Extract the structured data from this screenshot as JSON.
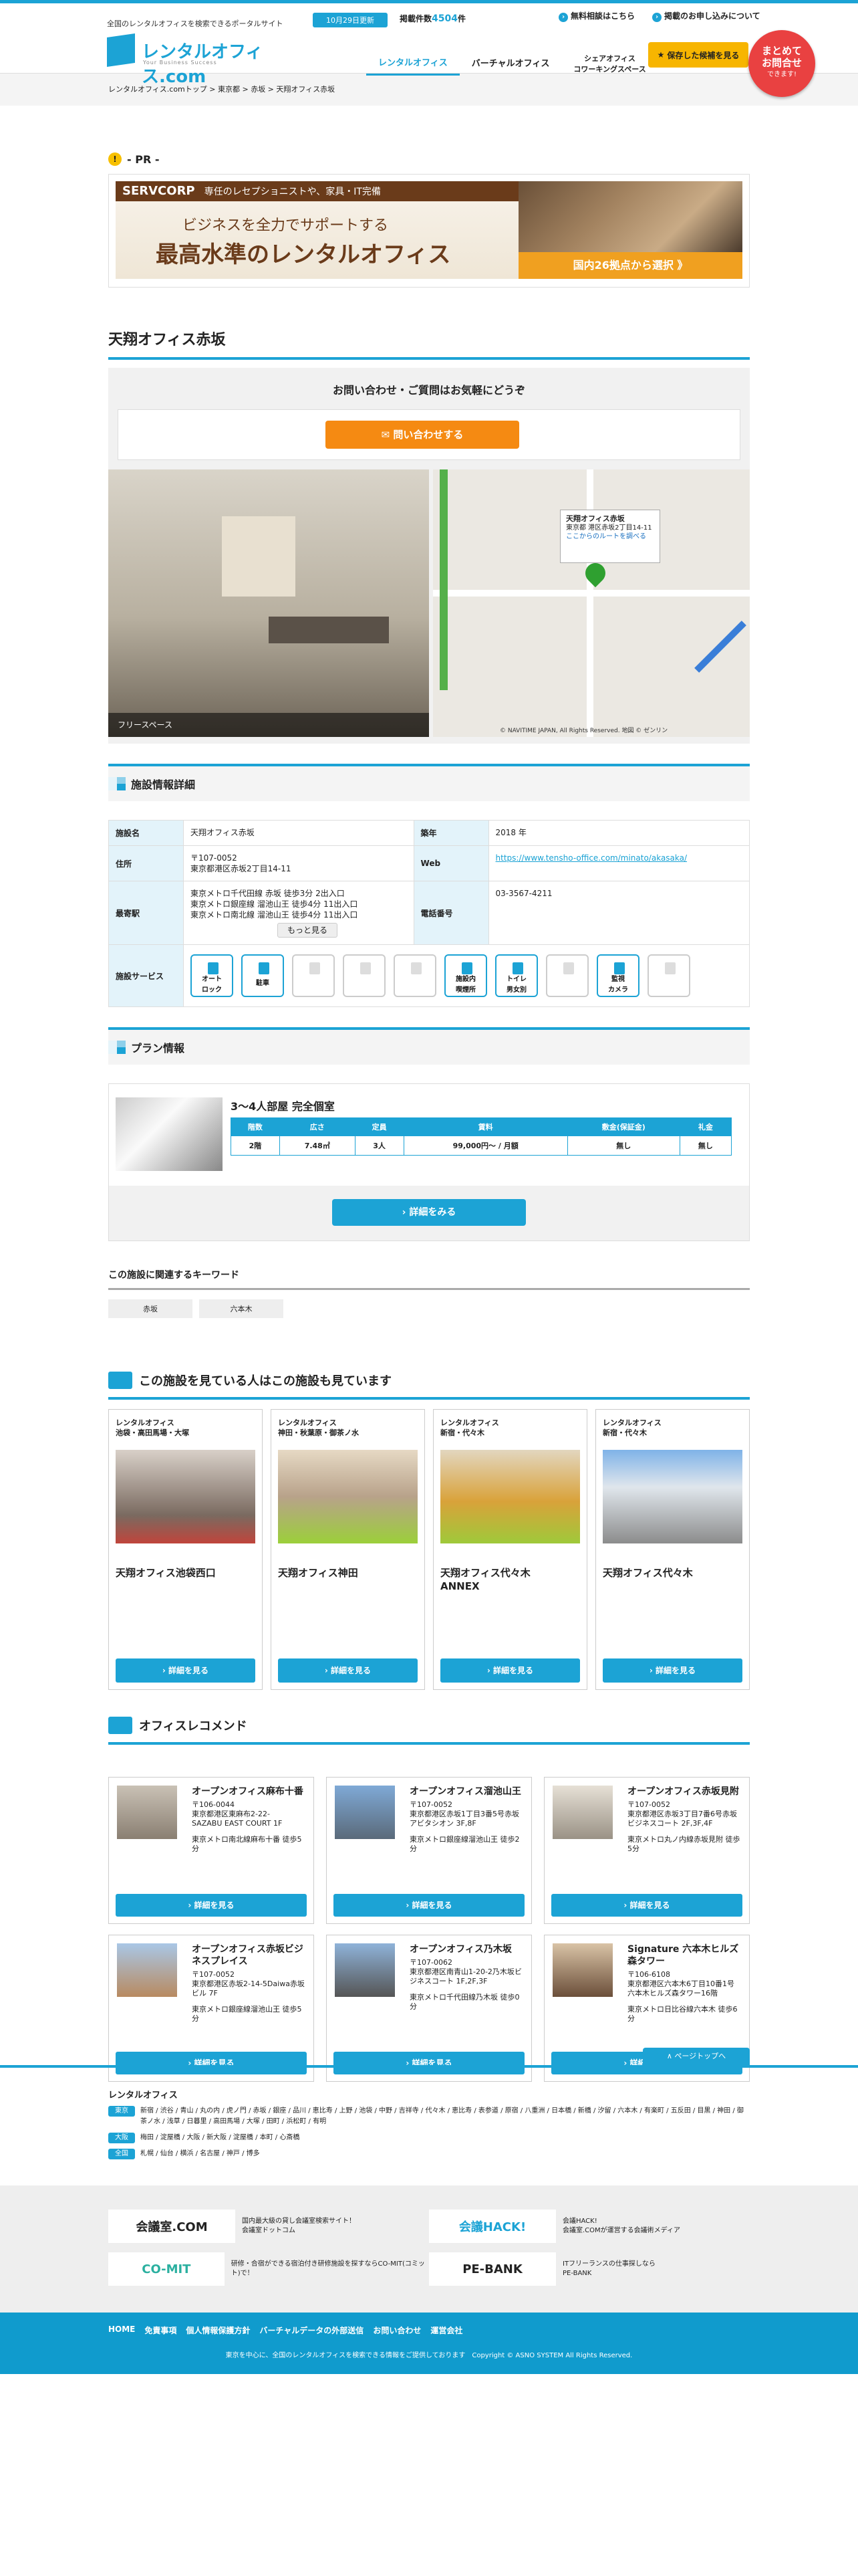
{
  "header": {
    "tagline": "全国のレンタルオフィスを検索できるポータルサイト",
    "logo": "レンタルオフィス.com",
    "logo_sub": "Your Business Success",
    "updated": "10月29日更新",
    "count_label": "掲載件数",
    "count": "4504",
    "count_unit": "件",
    "links": [
      "無料相談はこちら",
      "掲載のお申し込みについて"
    ],
    "nav": [
      "レンタルオフィス",
      "バーチャルオフィス",
      "シェアオフィス\nコワーキングスペース"
    ],
    "fav": "保存した候補を見る",
    "matome": "まとめて\nお問合せ",
    "matome_sub": "できます!"
  },
  "breadcrumb": "レンタルオフィス.comトップ > 東京都 > 赤坂 > 天翔オフィス赤坂",
  "pr": {
    "label": "- PR -",
    "brand": "SERVCORP",
    "top": "専任のレセプショニストや、家具・IT完備",
    "mid": "ビジネスを全力でサポートする",
    "big": "最高水準のレンタルオフィス",
    "cta": "国内26拠点から選択 》"
  },
  "facility": {
    "name": "天翔オフィス赤坂",
    "inquiry_title": "お問い合わせ・ご質問はお気軽にどうぞ",
    "inquiry_button": "問い合わせする",
    "photo_caption": "フリースペース",
    "map_name": "天翔オフィス赤坂",
    "map_addr": "東京都 港区赤坂2丁目14-11",
    "map_link": "ここからのルートを調べる",
    "map_copy": "© NAVITIME JAPAN, All Rights Reserved. 地図 © ゼンリン"
  },
  "detail": {
    "title": "施設情報詳細",
    "name_k": "施設名",
    "name_v": "天翔オフィス赤坂",
    "year_k": "築年",
    "year_v": "2018 年",
    "addr_k": "住所",
    "addr_v1": "〒107-0052",
    "addr_v2": "東京都港区赤坂2丁目14-11",
    "web_k": "Web",
    "web_v": "https://www.tensho-office.com/minato/akasaka/",
    "st_k": "最寄駅",
    "st_v1": "東京メトロ千代田線 赤坂 徒歩3分 2出入口",
    "st_v2": "東京メトロ銀座線 溜池山王 徒歩4分 11出入口",
    "st_v3": "東京メトロ南北線 溜池山王 徒歩4分 11出入口",
    "more": "もっと見る",
    "tel_k": "電話番号",
    "tel_v": "03-3567-4211",
    "svc_k": "施設サービス",
    "services": [
      "オート\nロック",
      "駐車",
      "",
      "",
      "",
      "施設内\n喫煙所",
      "トイレ\n男女別",
      "",
      "監視\nカメラ",
      ""
    ]
  },
  "plan": {
    "title": "プラン情報",
    "room": "3〜4人部屋 完全個室",
    "heads": [
      "階数",
      "広さ",
      "定員",
      "賃料",
      "敷金(保証金)",
      "礼金"
    ],
    "vals": [
      "2階",
      "7.48㎡",
      "3人",
      "99,000円〜 / 月額",
      "無し",
      "無し"
    ],
    "button": "詳細をみる"
  },
  "keywords": {
    "title": "この施設に関連するキーワード",
    "items": [
      "赤坂",
      "六本木"
    ]
  },
  "also": {
    "title": "この施設を見ている人はこの施設も見ています",
    "cards": [
      {
        "cat": "レンタルオフィス",
        "area": "池袋・高田馬場・大塚",
        "name": "天翔オフィス池袋西口"
      },
      {
        "cat": "レンタルオフィス",
        "area": "神田・秋葉原・御茶ノ水",
        "name": "天翔オフィス神田"
      },
      {
        "cat": "レンタルオフィス",
        "area": "新宿・代々木",
        "name": "天翔オフィス代々木\nANNEX"
      },
      {
        "cat": "レンタルオフィス",
        "area": "新宿・代々木",
        "name": "天翔オフィス代々木"
      }
    ],
    "button": "詳細を見る"
  },
  "recommend": {
    "title": "オフィスレコメンド",
    "button": "詳細を見る",
    "items": [
      {
        "name": "オープンオフィス麻布十番",
        "zip": "〒106-0044",
        "addr": "東京都港区東麻布2-22-\nSAZABU EAST COURT 1F",
        "st": "東京メトロ南北線麻布十番 徒歩5分"
      },
      {
        "name": "オープンオフィス溜池山王",
        "zip": "〒107-0052",
        "addr": "東京都港区赤坂1丁目3番5号赤坂アビタシオン 3F,8F",
        "st": "東京メトロ銀座線溜池山王 徒歩2分"
      },
      {
        "name": "オープンオフィス赤坂見附",
        "zip": "〒107-0052",
        "addr": "東京都港区赤坂3丁目7番6号赤坂ビジネスコート 2F,3F,4F",
        "st": "東京メトロ丸ノ内線赤坂見附 徒歩5分"
      },
      {
        "name": "オープンオフィス赤坂ビジネスプレイス",
        "zip": "〒107-0052",
        "addr": "東京都港区赤坂2-14-5Daiwa赤坂ビル 7F",
        "st": "東京メトロ銀座線溜池山王 徒歩5分"
      },
      {
        "name": "オープンオフィス乃木坂",
        "zip": "〒107-0062",
        "addr": "東京都港区南青山1-20-2乃木坂ビジネスコート 1F,2F,3F",
        "st": "東京メトロ千代田線乃木坂 徒歩0分"
      },
      {
        "name": "Signature 六本木ヒルズ森タワー",
        "zip": "〒106-6108",
        "addr": "東京都港区六本木6丁目10番1号六本木ヒルズ森タワー16階",
        "st": "東京メトロ日比谷線六本木 徒歩6分"
      }
    ]
  },
  "pagetop": "∧ ページトップへ",
  "footer": {
    "title": "レンタルオフィス",
    "areas": [
      {
        "r": "東京",
        "t": "新宿 / 渋谷 / 青山 / 丸の内 / 虎ノ門 / 赤坂 / 銀座 / 品川 / 恵比寿 / 上野 / 池袋 / 中野 / 吉祥寺 / 代々木 / 恵比寿 / 表参道 / 原宿 / 八重洲 / 日本橋 / 新橋 / 汐留 / 六本木 / 有楽町 / 五反田 / 目黒 / 神田 / 御茶ノ水 / 浅草 / 日暮里 / 高田馬場 / 大塚 / 田町 / 浜松町 / 有明"
      },
      {
        "r": "大阪",
        "t": "梅田 / 淀屋橋 / 大阪 / 新大阪 / 淀屋橋 / 本町 / 心斎橋"
      },
      {
        "r": "全国",
        "t": "札幌 / 仙台 / 横浜 / 名古屋 / 神戸 / 博多"
      }
    ],
    "banners": [
      {
        "logo": "会議室.COM",
        "text": "国内最大級の貸し会議室検索サイト！\n会議室ドットコム"
      },
      {
        "logo": "会議HACK!",
        "text": "会議HACK!\n会議室.COMが運営する会議術メディア"
      },
      {
        "logo": "CO-MIT",
        "text": "研修・合宿ができる宿泊付き研修施設を探すならCO-MIT(コミット)で！"
      },
      {
        "logo": "PE-BANK",
        "text": "ITフリーランスの仕事探しなら\nPE-BANK"
      }
    ],
    "nav": [
      "HOME",
      "免責事項",
      "個人情報保護方針",
      "バーチャルデータの外部送信",
      "お問い合わせ",
      "運営会社"
    ],
    "copy": "東京を中心に、全国のレンタルオフィスを検索できる情報をご提供しております　Copyright © ASNO SYSTEM All Rights Reserved."
  }
}
